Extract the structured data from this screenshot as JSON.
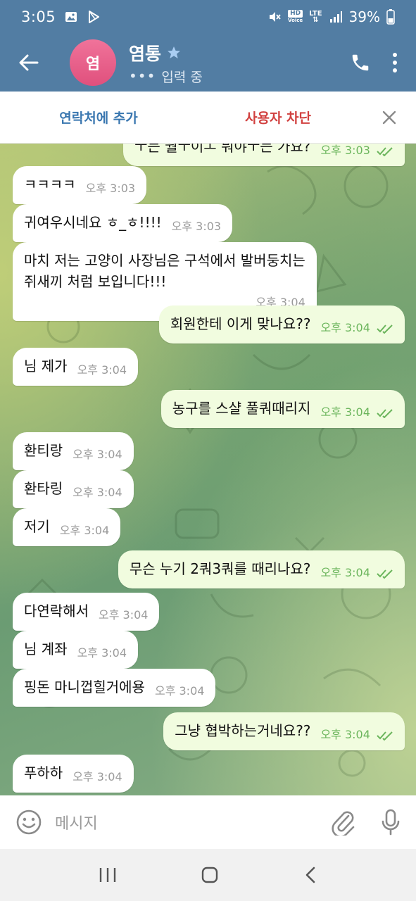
{
  "status_bar": {
    "time": "3:05",
    "hd_badge": "HD",
    "voice_badge": "Voice",
    "network": "LTE",
    "battery": "39%"
  },
  "header": {
    "avatar_text": "염",
    "contact_name": "염통",
    "status_dots": "•••",
    "status_text": "입력 중"
  },
  "action_bar": {
    "add_contact": "연락처에 추가",
    "block_user": "사용자 차단"
  },
  "messages": [
    {
      "dir": "out",
      "text": "ㅜ는 월ㅜ이ㅗ 뭐야ㅜ는 가요?",
      "time": "오후 3:03"
    },
    {
      "dir": "in",
      "text": "ㅋㅋㅋㅋ",
      "time": "오후 3:03"
    },
    {
      "dir": "in",
      "text": "귀여우시네요 ㅎ_ㅎ!!!!",
      "time": "오후 3:03"
    },
    {
      "dir": "in",
      "line1": "마치 저는 고양이 사장님은 구석에서 발버둥치는",
      "line2": "쥐새끼 처럼 보입니다!!!",
      "time": "오후 3:04"
    },
    {
      "dir": "out",
      "text": "회원한테 이게 맞나요??",
      "time": "오후 3:04"
    },
    {
      "dir": "in",
      "text": "님 제가",
      "time": "오후 3:04"
    },
    {
      "dir": "out",
      "text": "농구를 스샬 풀쿼때리지",
      "time": "오후 3:04"
    },
    {
      "dir": "in",
      "text": "환티랑",
      "time": "오후 3:04"
    },
    {
      "dir": "in",
      "text": "환타링",
      "time": "오후 3:04"
    },
    {
      "dir": "in",
      "text": "저기",
      "time": "오후 3:04"
    },
    {
      "dir": "out",
      "text": "무슨 누기 2쿼3쿼를 때리나요?",
      "time": "오후 3:04"
    },
    {
      "dir": "in",
      "text": "다연락해서",
      "time": "오후 3:04"
    },
    {
      "dir": "in",
      "text": "님 계좌",
      "time": "오후 3:04"
    },
    {
      "dir": "in",
      "text": "핑돈 마니껍힐거에용",
      "time": "오후 3:04"
    },
    {
      "dir": "out",
      "text": "그냥 협박하는거네요??",
      "time": "오후 3:04"
    },
    {
      "dir": "in",
      "text": "푸하하",
      "time": "오후 3:04"
    }
  ],
  "input": {
    "placeholder": "메시지"
  },
  "colors": {
    "header_bg": "#527da3",
    "avatar": "#e95e89",
    "add_contact": "#3a77b0",
    "block_user": "#d1403f",
    "outgoing_bubble": "#f1fcdf",
    "read_check": "#6bb55c"
  },
  "icons": [
    "back-arrow-icon",
    "star-icon",
    "phone-icon",
    "more-vert-icon",
    "close-icon",
    "emoji-icon",
    "attach-icon",
    "mic-icon",
    "recents-icon",
    "home-icon",
    "nav-back-icon"
  ]
}
